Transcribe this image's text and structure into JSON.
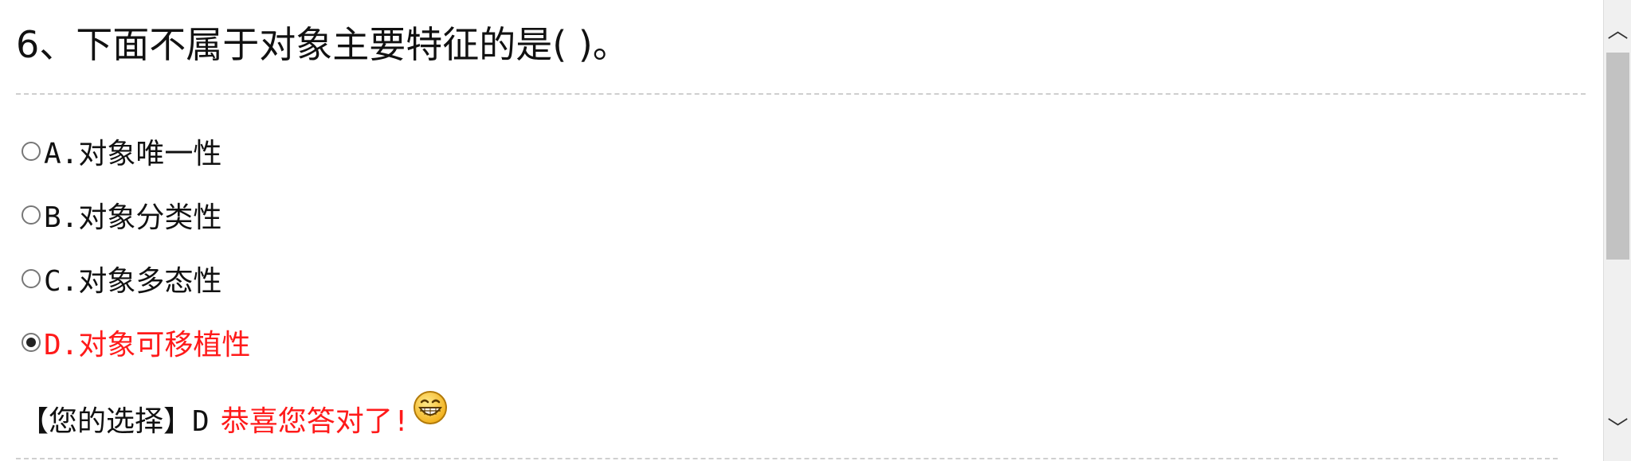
{
  "question": {
    "title": "6、下面不属于对象主要特征的是( )。"
  },
  "options": [
    {
      "label": "A.对象唯一性",
      "selected": false
    },
    {
      "label": "B.对象分类性",
      "selected": false
    },
    {
      "label": "C.对象多态性",
      "selected": false
    },
    {
      "label": "D.对象可移植性",
      "selected": true
    }
  ],
  "result": {
    "prefix": "【您的选择】D",
    "message": "恭喜您答对了!",
    "icon": "grinning-face-icon"
  },
  "colors": {
    "selected_text": "#ff1a1a",
    "divider": "#cfcfcf"
  },
  "scrollbar": {
    "up_glyph": "︿",
    "down_glyph": "﹀"
  }
}
